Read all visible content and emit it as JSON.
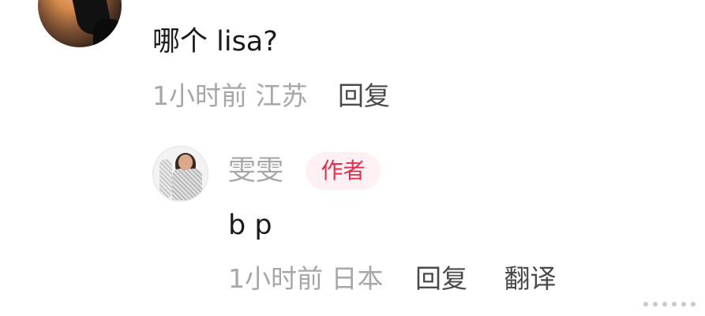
{
  "top_comment": {
    "text": "哪个 lisa?",
    "time": "1小时前",
    "location": "江苏",
    "reply_label": "回复"
  },
  "reply_comment": {
    "username": "雯雯",
    "badge": "作者",
    "text": "b p",
    "time": "1小时前",
    "location": "日本",
    "reply_label": "回复",
    "translate_label": "翻译"
  },
  "colors": {
    "primary_text": "#1b1b1b",
    "meta_text": "#a7a7a7",
    "action_text": "#4a4a4a",
    "badge_text": "#e32d4a",
    "badge_bg": "#fff1f3"
  },
  "icons": {
    "top_avatar": "avatar-icon",
    "reply_avatar": "avatar-icon"
  }
}
